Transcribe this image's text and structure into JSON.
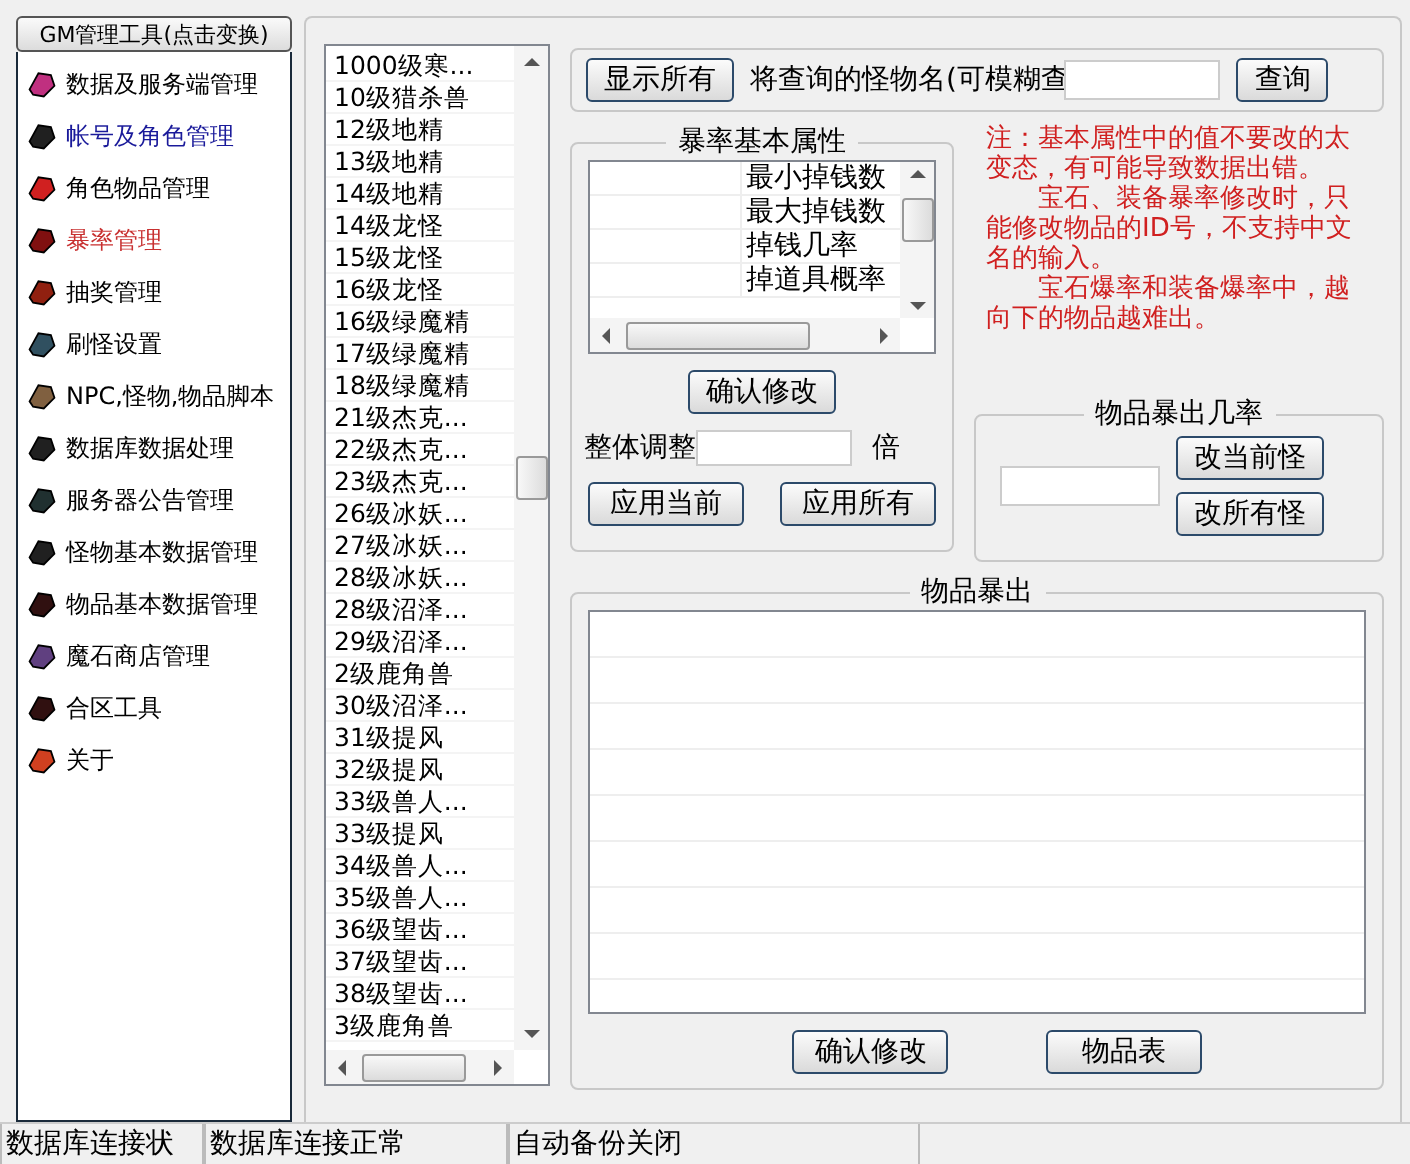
{
  "sidebar": {
    "header": "GM管理工具(点击变换)",
    "items": [
      {
        "label": "数据及服务端管理",
        "selected": false,
        "hovered": false
      },
      {
        "label": "帐号及角色管理",
        "selected": false,
        "hovered": true
      },
      {
        "label": "角色物品管理",
        "selected": false,
        "hovered": false
      },
      {
        "label": "暴率管理",
        "selected": true,
        "hovered": false
      },
      {
        "label": "抽奖管理",
        "selected": false,
        "hovered": false
      },
      {
        "label": "刷怪设置",
        "selected": false,
        "hovered": false
      },
      {
        "label": "NPC,怪物,物品脚本",
        "selected": false,
        "hovered": false
      },
      {
        "label": "数据库数据处理",
        "selected": false,
        "hovered": false
      },
      {
        "label": "服务器公告管理",
        "selected": false,
        "hovered": false
      },
      {
        "label": "怪物基本数据管理",
        "selected": false,
        "hovered": false
      },
      {
        "label": "物品基本数据管理",
        "selected": false,
        "hovered": false
      },
      {
        "label": "魔石商店管理",
        "selected": false,
        "hovered": false
      },
      {
        "label": "合区工具",
        "selected": false,
        "hovered": false
      },
      {
        "label": "关于",
        "selected": false,
        "hovered": false
      }
    ]
  },
  "monster_list": {
    "items": [
      "1000级寒...",
      "10级猎杀兽",
      "12级地精",
      "13级地精",
      "14级地精",
      "14级龙怪",
      "15级龙怪",
      "16级龙怪",
      "16级绿魔精",
      "17级绿魔精",
      "18级绿魔精",
      "21级杰克...",
      "22级杰克...",
      "23级杰克...",
      "26级冰妖...",
      "27级冰妖...",
      "28级冰妖...",
      "28级沼泽...",
      "29级沼泽...",
      "2级鹿角兽",
      "30级沼泽...",
      "31级提风",
      "32级提风",
      "33级兽人...",
      "33级提风",
      "34级兽人...",
      "35级兽人...",
      "36级望齿...",
      "37级望齿...",
      "38级望齿...",
      "3级鹿角兽"
    ]
  },
  "search": {
    "show_all_button": "显示所有",
    "label": "将查询的怪物名(可模糊查",
    "query_button": "查询"
  },
  "drop_attributes": {
    "title": "暴率基本属性",
    "rows": [
      "最小掉钱数",
      "最大掉钱数",
      "掉钱几率",
      "掉道具概率"
    ],
    "confirm_button": "确认修改",
    "scale_label": "整体调整",
    "scale_unit": "倍",
    "apply_current_button": "应用当前",
    "apply_all_button": "应用所有"
  },
  "note": {
    "paragraphs": [
      "注：基本属性中的值不要改的太变态，有可能导致数据出错。",
      "宝石、装备暴率修改时，只能修改物品的ID号，不支持中文名的输入。",
      "宝石爆率和装备爆率中，越向下的物品越难出。"
    ]
  },
  "drop_chance": {
    "title": "物品暴出几率",
    "change_current_button": "改当前怪",
    "change_all_button": "改所有怪"
  },
  "item_drops": {
    "title": "物品暴出",
    "confirm_button": "确认修改",
    "item_table_button": "物品表"
  },
  "status_bar": [
    "数据库连接状",
    "数据库连接正常",
    "自动备份关闭"
  ]
}
